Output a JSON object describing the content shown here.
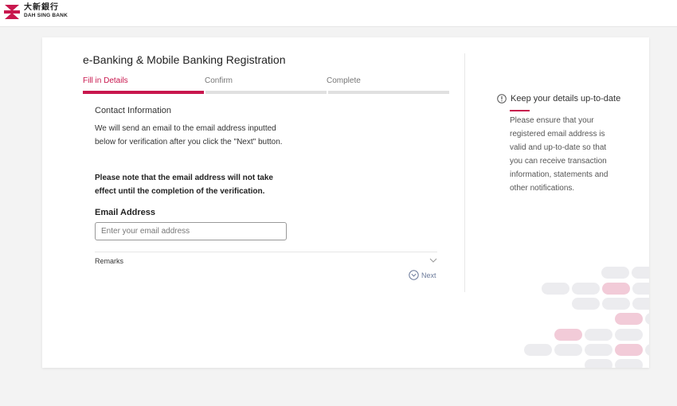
{
  "header": {
    "logo_cn": "大新銀行",
    "logo_en": "DAH SING BANK",
    "brand_color": "#c8174e"
  },
  "registration": {
    "title": "e-Banking & Mobile Banking Registration",
    "steps": [
      {
        "label": "Fill in Details",
        "active": true
      },
      {
        "label": "Confirm",
        "active": false
      },
      {
        "label": "Complete",
        "active": false
      }
    ],
    "section_title": "Contact Information",
    "description": "We will send an email to the email address inputted below for verification after you click the \"Next\" button.",
    "note": "Please note that the email address will not take effect until the completion of the verification.",
    "email": {
      "label": "Email Address",
      "placeholder": "Enter your email address",
      "value": ""
    },
    "remarks_label": "Remarks",
    "next_label": "Next"
  },
  "tip": {
    "icon": "info-icon",
    "title": "Keep your details up-to-date",
    "text": "Please ensure that your registered email address is valid and up-to-date so that you can receive transaction information, statements and other notifications."
  }
}
